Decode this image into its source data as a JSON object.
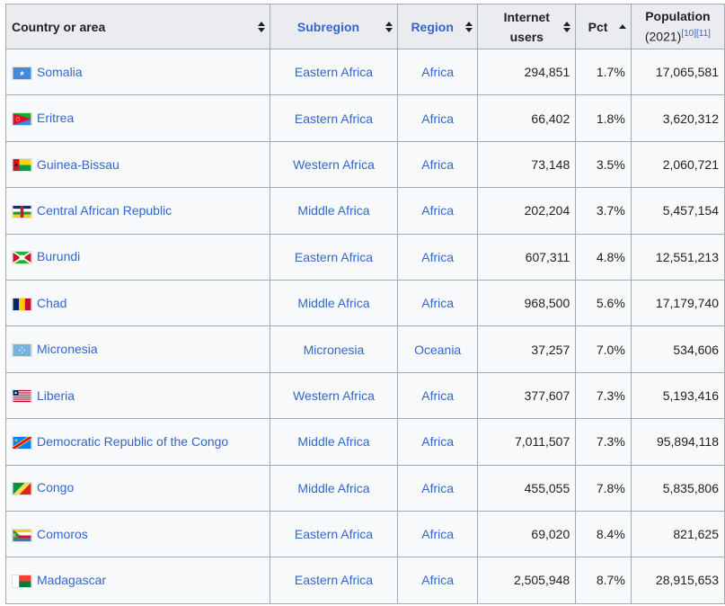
{
  "table": {
    "headers": {
      "country": "Country or area",
      "subregion": "Subregion",
      "region": "Region",
      "users_line1": "Internet",
      "users_line2": "users",
      "pct": "Pct",
      "pop_line1": "Population",
      "pop_line2": "(2021)",
      "pop_refs": "[10][11]"
    },
    "rows": [
      {
        "country": "Somalia",
        "subregion": "Eastern Africa",
        "region": "Africa",
        "users": "294,851",
        "pct": "1.7%",
        "population": "17,065,581",
        "flag": "somalia-flag"
      },
      {
        "country": "Eritrea",
        "subregion": "Eastern Africa",
        "region": "Africa",
        "users": "66,402",
        "pct": "1.8%",
        "population": "3,620,312",
        "flag": "eritrea-flag"
      },
      {
        "country": "Guinea-Bissau",
        "subregion": "Western Africa",
        "region": "Africa",
        "users": "73,148",
        "pct": "3.5%",
        "population": "2,060,721",
        "flag": "guinea-bissau-flag"
      },
      {
        "country": "Central African Republic",
        "subregion": "Middle Africa",
        "region": "Africa",
        "users": "202,204",
        "pct": "3.7%",
        "population": "5,457,154",
        "flag": "car-flag"
      },
      {
        "country": "Burundi",
        "subregion": "Eastern Africa",
        "region": "Africa",
        "users": "607,311",
        "pct": "4.8%",
        "population": "12,551,213",
        "flag": "burundi-flag"
      },
      {
        "country": "Chad",
        "subregion": "Middle Africa",
        "region": "Africa",
        "users": "968,500",
        "pct": "5.6%",
        "population": "17,179,740",
        "flag": "chad-flag"
      },
      {
        "country": "Micronesia",
        "subregion": "Micronesia",
        "region": "Oceania",
        "users": "37,257",
        "pct": "7.0%",
        "population": "534,606",
        "flag": "micronesia-flag"
      },
      {
        "country": "Liberia",
        "subregion": "Western Africa",
        "region": "Africa",
        "users": "377,607",
        "pct": "7.3%",
        "population": "5,193,416",
        "flag": "liberia-flag"
      },
      {
        "country": "Democratic Republic of the Congo",
        "subregion": "Middle Africa",
        "region": "Africa",
        "users": "7,011,507",
        "pct": "7.3%",
        "population": "95,894,118",
        "flag": "drc-flag"
      },
      {
        "country": "Congo",
        "subregion": "Middle Africa",
        "region": "Africa",
        "users": "455,055",
        "pct": "7.8%",
        "population": "5,835,806",
        "flag": "congo-flag"
      },
      {
        "country": "Comoros",
        "subregion": "Eastern Africa",
        "region": "Africa",
        "users": "69,020",
        "pct": "8.4%",
        "population": "821,625",
        "flag": "comoros-flag"
      },
      {
        "country": "Madagascar",
        "subregion": "Eastern Africa",
        "region": "Africa",
        "users": "2,505,948",
        "pct": "8.7%",
        "population": "28,915,653",
        "flag": "madagascar-flag"
      }
    ]
  },
  "colors": {
    "link": "#3366cc",
    "header_bg": "#eaecf0",
    "row_bg": "#f8f9fa",
    "border": "#a2a9b1"
  },
  "sort_state": {
    "pct": "ascending"
  }
}
